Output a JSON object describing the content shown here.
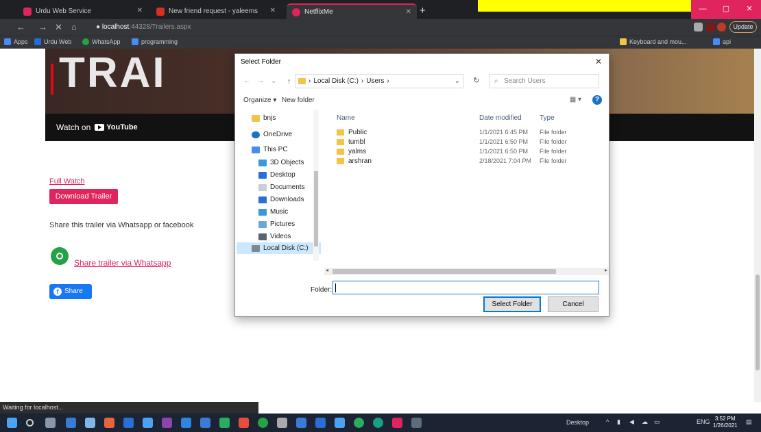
{
  "browser": {
    "tabs": [
      {
        "title": "Urdu Web Service",
        "color": "#e0245e"
      },
      {
        "title": "New friend request - yaleems",
        "color": "#d93025"
      },
      {
        "title": "NetflixMe",
        "color": "#e0245e"
      }
    ],
    "url_host": "localhost",
    "url_path": ":44328/Trailers.aspx",
    "update_label": "Update",
    "bookmarks": [
      "Apps",
      "Urdu Web",
      "WhatsApp",
      "programming",
      "Keyboard and mou...",
      "api"
    ],
    "status": "Waiting for localhost..."
  },
  "page": {
    "poster_text": "TRAI",
    "watch_on": "Watch on",
    "youtube_label": "YouTube",
    "full_watch_link": "Full Watch",
    "download_button": "Download Trailer",
    "share_text": "Share this trailer via Whatsapp or facebook",
    "whatsapp_link": "Share trailer via Whatsapp",
    "fb_share_button": "Share",
    "accent_color": "#e0245e"
  },
  "dialog": {
    "title": "Select Folder",
    "breadcrumb": [
      "Local Disk (C:)",
      "Users"
    ],
    "search_placeholder": "Search Users",
    "organize": "Organize ▾",
    "new_folder": "New folder",
    "tree": [
      {
        "label": "bnjs",
        "icon": "folder-icon"
      },
      {
        "label": "OneDrive",
        "icon": "cloud-icon"
      },
      {
        "label": "This PC",
        "icon": "computer-icon"
      },
      {
        "label": "3D Objects",
        "icon": "cube-icon"
      },
      {
        "label": "Desktop",
        "icon": "desktop-icon"
      },
      {
        "label": "Documents",
        "icon": "document-icon"
      },
      {
        "label": "Downloads",
        "icon": "download-icon"
      },
      {
        "label": "Music",
        "icon": "music-icon"
      },
      {
        "label": "Pictures",
        "icon": "pictures-icon"
      },
      {
        "label": "Videos",
        "icon": "video-icon"
      },
      {
        "label": "Local Disk (C:)",
        "icon": "drive-icon"
      }
    ],
    "columns": {
      "name": "Name",
      "date": "Date modified",
      "type": "Type"
    },
    "files": [
      {
        "name": "Public",
        "date": "1/1/2021 6:45 PM",
        "type": "File folder"
      },
      {
        "name": "tumbl",
        "date": "1/1/2021 6:50 PM",
        "type": "File folder"
      },
      {
        "name": "yalms",
        "date": "1/1/2021 6:50 PM",
        "type": "File folder"
      },
      {
        "name": "arshran",
        "date": "2/18/2021 7:04 PM",
        "type": "File folder"
      }
    ],
    "folder_label": "Folder:",
    "folder_value": "",
    "select_button": "Select Folder",
    "cancel_button": "Cancel"
  },
  "taskbar": {
    "desktop_label": "Desktop",
    "language": "ENG",
    "time": "3:52 PM",
    "date": "1/26/2021"
  }
}
